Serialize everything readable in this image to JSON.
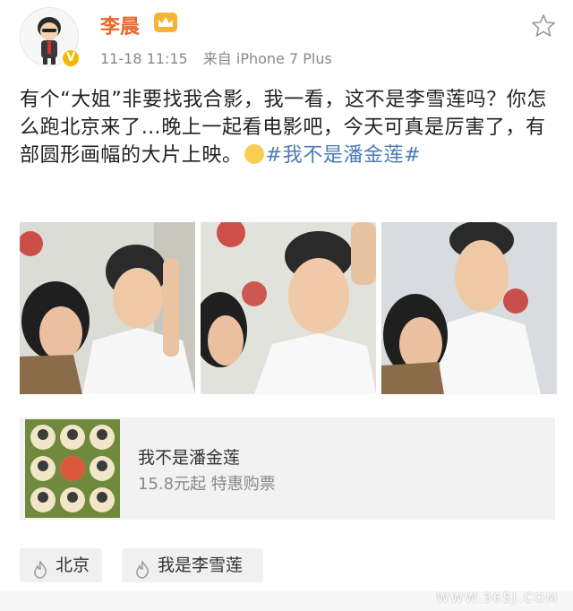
{
  "post": {
    "author": "李晨",
    "timestamp": "11-18 11:15",
    "source": "来自 iPhone 7 Plus",
    "text_before": "有个“大姐”非要找我合影，我一看，这不是李雪莲吗？你怎么跑北京来了…晚上一起看电影吧，今天可真是厉害了，有部圆形画幅的大片上映。",
    "topic": "#我不是潘金莲#"
  },
  "icons": {
    "verified": "verified-v-icon",
    "vip": "crown-icon",
    "favorite": "star-icon",
    "emoji": "emoji-face-icon",
    "location": "flame-icon"
  },
  "photos": [
    {
      "name": "selfie-photo-1"
    },
    {
      "name": "selfie-photo-2"
    },
    {
      "name": "selfie-photo-3"
    }
  ],
  "card": {
    "title": "我不是潘金莲",
    "subtitle": "15.8元起 特惠购票"
  },
  "tags": [
    {
      "label": "北京"
    },
    {
      "label": "我是李雪莲"
    }
  ],
  "watermark": "WWW.365J.COM",
  "colors": {
    "username": "#e9672c",
    "topic": "#4c7bb6",
    "verified": "#f5b800"
  }
}
